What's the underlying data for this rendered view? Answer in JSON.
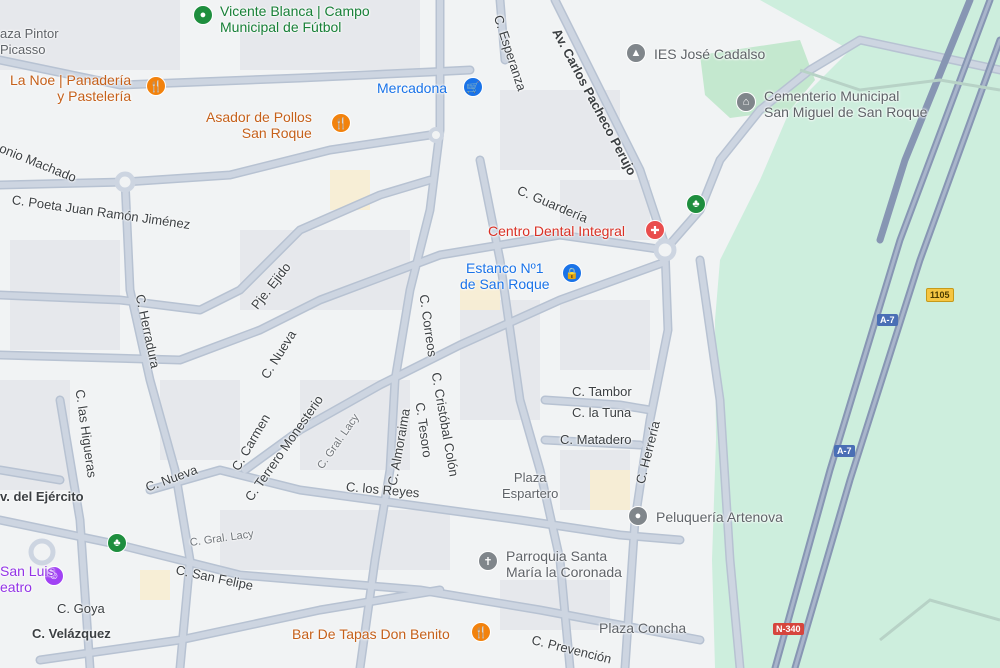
{
  "colors": {
    "background": "#f1f3f4",
    "block": "#e8eaed",
    "road": "#c6d0de",
    "road_edge": "#b2bdcd",
    "highway": "#8796b3",
    "green_area": "#cdeedd",
    "poi_orange": "#f2820d",
    "poi_blue": "#1a73e8"
  },
  "streets": {
    "av_carlos_pacheco": "Av. Carlos Pacheco Perujo",
    "c_esperanza": "C. Esperanza",
    "antonio_machado": "onio Machado",
    "poeta_jrj": "C. Poeta Juan Ramón Jiménez",
    "c_guarderia": "C. Guardería",
    "pje_ejido": "Pje. Ejido",
    "c_herradura": "C. Herradura",
    "c_nueva_1": "C. Nueva",
    "c_correos": "C. Correos",
    "c_tambor": "C. Tambor",
    "c_la_tuna": "C. la Tuna",
    "c_matadero": "C. Matadero",
    "c_herreria": "C. Herrería",
    "c_las_higueras": "C. las Higueras",
    "c_carmen": "C. Carmen",
    "c_terrero_monesterio": "C. Terrero Monesterio",
    "c_gral_lacy_1": "C. Gral. Lacy",
    "c_almoraima": "C. Almoraima",
    "c_tesoro": "C. Tesoro",
    "c_cristobal_colon": "C. Cristóbal Colón",
    "c_los_reyes": "C. los Reyes",
    "av_ejercito": "v. del Ejército",
    "c_nueva_2": "C. Nueva",
    "c_gral_lacy_2": "C. Gral. Lacy",
    "c_san_felipe": "C. San Felipe",
    "c_goya": "C. Goya",
    "c_velazquez": "C. Velázquez",
    "c_prevencion": "C. Prevención"
  },
  "places": {
    "plaza_pintor": "aza Pintor\nPicasso",
    "plaza_espartero": "Plaza\nEspartero",
    "plaza_concha": "Plaza Concha"
  },
  "pois": {
    "vicente_blanca": "Vicente Blanca | Campo\nMunicipal de Fútbol",
    "la_noe": "La Noe | Panadería\ny Pastelería",
    "mercadona": "Mercadona",
    "asador": "Asador de Pollos\nSan Roque",
    "ies": "IES José Cadalso",
    "cementerio": "Cementerio Municipal\nSan Miguel de San Roque",
    "centro_dental": "Centro Dental Integral",
    "estanco": "Estanco Nº1\nde San Roque",
    "peluqueria": "Peluquería Artenova",
    "parroquia": "Parroquia Santa\nMaría la Coronada",
    "bar_tapas": "Bar De Tapas Don Benito",
    "san_luis": "San Luis\neatro"
  },
  "roads": {
    "shield_1105": "1105",
    "shield_a7_1": "A-7",
    "shield_a7_2": "A-7",
    "shield_n340": "N-340"
  }
}
